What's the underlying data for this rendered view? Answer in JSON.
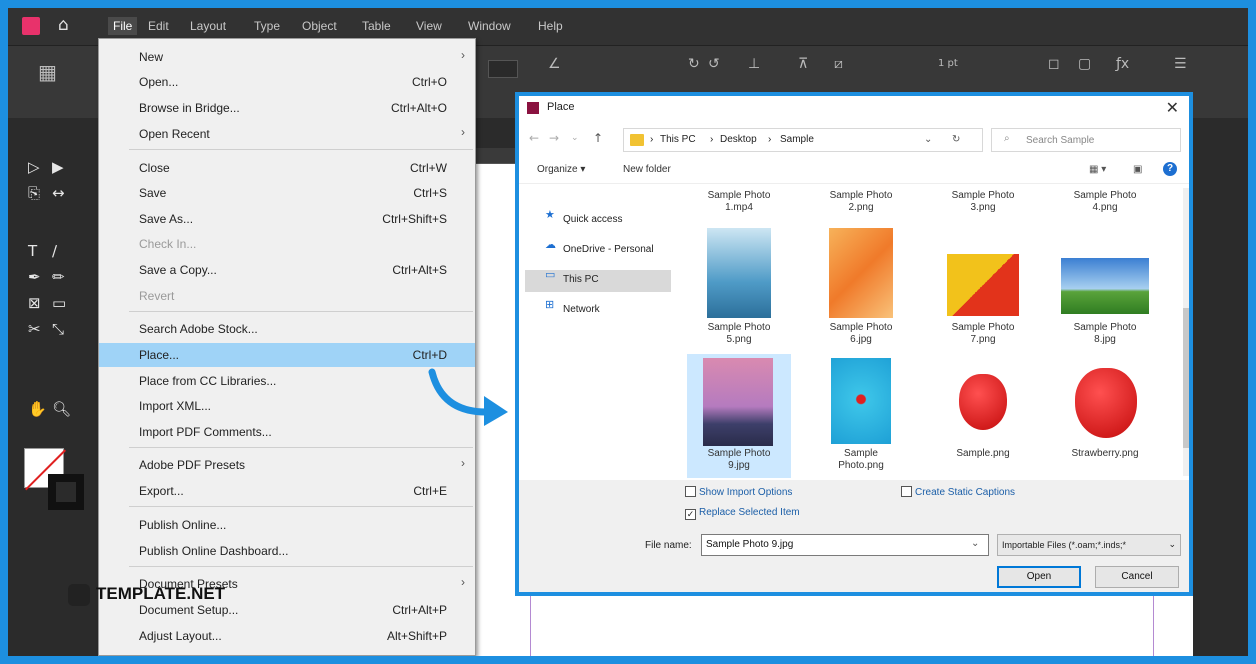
{
  "menubar": {
    "items": [
      "File",
      "Edit",
      "Layout",
      "Type",
      "Object",
      "Table",
      "View",
      "Window",
      "Help"
    ]
  },
  "control": {
    "stroke": "1 pt"
  },
  "file_menu": {
    "items": [
      {
        "label": "New",
        "shortcut": "",
        "arrow": "›"
      },
      {
        "label": "Open...",
        "shortcut": "Ctrl+O",
        "arrow": ""
      },
      {
        "label": "Browse in Bridge...",
        "shortcut": "Ctrl+Alt+O",
        "arrow": ""
      },
      {
        "label": "Open Recent",
        "shortcut": "",
        "arrow": "›"
      },
      {
        "label": "Close",
        "shortcut": "Ctrl+W",
        "arrow": ""
      },
      {
        "label": "Save",
        "shortcut": "Ctrl+S",
        "arrow": ""
      },
      {
        "label": "Save As...",
        "shortcut": "Ctrl+Shift+S",
        "arrow": ""
      },
      {
        "label": "Check In...",
        "shortcut": "",
        "arrow": ""
      },
      {
        "label": "Save a Copy...",
        "shortcut": "Ctrl+Alt+S",
        "arrow": ""
      },
      {
        "label": "Revert",
        "shortcut": "",
        "arrow": ""
      },
      {
        "label": "Search Adobe Stock...",
        "shortcut": "",
        "arrow": ""
      },
      {
        "label": "Place...",
        "shortcut": "Ctrl+D",
        "arrow": ""
      },
      {
        "label": "Place from CC Libraries...",
        "shortcut": "",
        "arrow": ""
      },
      {
        "label": "Import XML...",
        "shortcut": "",
        "arrow": ""
      },
      {
        "label": "Import PDF Comments...",
        "shortcut": "",
        "arrow": ""
      },
      {
        "label": "Adobe PDF Presets",
        "shortcut": "",
        "arrow": "›"
      },
      {
        "label": "Export...",
        "shortcut": "Ctrl+E",
        "arrow": ""
      },
      {
        "label": "Publish Online...",
        "shortcut": "",
        "arrow": ""
      },
      {
        "label": "Publish Online Dashboard...",
        "shortcut": "",
        "arrow": ""
      },
      {
        "label": "Document Presets",
        "shortcut": "",
        "arrow": "›"
      },
      {
        "label": "Document Setup...",
        "shortcut": "Ctrl+Alt+P",
        "arrow": ""
      },
      {
        "label": "Adjust Layout...",
        "shortcut": "Alt+Shift+P",
        "arrow": ""
      }
    ]
  },
  "dialog": {
    "title": "Place",
    "path": [
      "This PC",
      "Desktop",
      "Sample"
    ],
    "search_placeholder": "Search Sample",
    "organize": "Organize ▾",
    "new_folder": "New folder",
    "nav": [
      "Quick access",
      "OneDrive - Personal",
      "This PC",
      "Network"
    ],
    "top_captions": [
      [
        "Sample Photo",
        "1.mp4"
      ],
      [
        "Sample Photo",
        "2.png"
      ],
      [
        "Sample Photo",
        "3.png"
      ],
      [
        "Sample Photo",
        "4.png"
      ]
    ],
    "files": [
      {
        "name1": "Sample Photo",
        "name2": "5.png"
      },
      {
        "name1": "Sample Photo",
        "name2": "6.jpg"
      },
      {
        "name1": "Sample Photo",
        "name2": "7.png"
      },
      {
        "name1": "Sample Photo",
        "name2": "8.jpg"
      },
      {
        "name1": "Sample Photo",
        "name2": "9.jpg"
      },
      {
        "name1": "Sample",
        "name2": "Photo.png"
      },
      {
        "name1": "Sample.png",
        "name2": ""
      },
      {
        "name1": "Strawberry.png",
        "name2": ""
      }
    ],
    "show_import_options": "Show Import Options",
    "create_static_captions": "Create Static Captions",
    "replace_selected_item": "Replace Selected Item",
    "file_name_label": "File name:",
    "file_name_value": "Sample Photo 9.jpg",
    "file_type": "Importable Files (*.oam;*.inds;*",
    "open": "Open",
    "cancel": "Cancel"
  },
  "watermark": {
    "text": "TEMPLATE.NET"
  }
}
